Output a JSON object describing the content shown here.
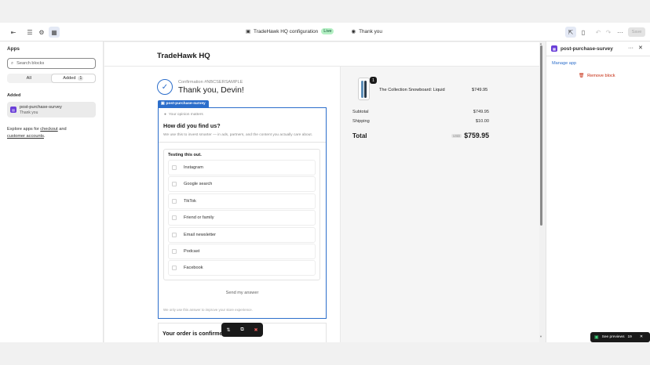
{
  "topbar": {
    "config_title": "TradeHawk HQ configuration",
    "live_badge": "Live",
    "page_label": "Thank you",
    "save_label": "Save",
    "more_label": "···"
  },
  "left": {
    "title": "Apps",
    "search_placeholder": "Search blocks",
    "tab_all": "All",
    "tab_added": "Added",
    "added_count": "1",
    "added_section": "Added",
    "app_name": "post-purchase-survey",
    "app_sub": "Thank you",
    "explore_prefix": "Explore apps for",
    "explore_link1": "checkout",
    "explore_and": "and",
    "explore_link2": "customer accounts",
    "explore_end": "."
  },
  "preview": {
    "store_name": "TradeHawk HQ",
    "confirmation": "Confirmation #NBCSERSAMPLE",
    "thanks": "Thank you, Devin!",
    "block_tag": "post-purchase-survey",
    "optional_line": "Your opinion matters",
    "question": "How did you find us?",
    "question_desc": "We use this to invest smarter — in ads, partners, and the content you actually care about.",
    "choices_title": "Testing this out.",
    "choices": [
      "Instagram",
      "Google search",
      "TikTok",
      "Friend or family",
      "Email newsletter",
      "Podcast",
      "Facebook"
    ],
    "send_label": "Send my answer",
    "footnote": "We only use this answer to improve your store experience.",
    "order_confirmed": "Your order is confirmed"
  },
  "summary": {
    "quantity": "1",
    "product_name": "The Collection Snowboard: Liquid",
    "product_price": "$749.95",
    "subtotal_label": "Subtotal",
    "subtotal_value": "$749.95",
    "shipping_label": "Shipping",
    "shipping_value": "$10.00",
    "total_label": "Total",
    "currency": "USD",
    "total_value": "$759.95"
  },
  "right": {
    "title": "post-purchase-survey",
    "manage_app": "Manage app",
    "remove_block": "Remove block"
  },
  "toast": {
    "text": "See previews",
    "count": "19"
  },
  "colors": {
    "accent": "#2c6ecb",
    "app_logo": "#6a3fd8",
    "danger": "#c5280c"
  }
}
